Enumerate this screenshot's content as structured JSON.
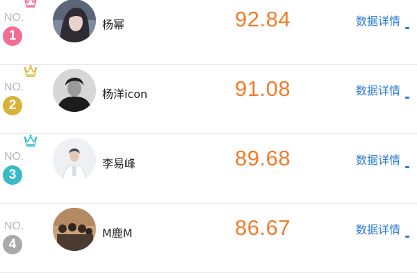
{
  "ranking": {
    "items": [
      {
        "no_label": "NO.",
        "rank": "1",
        "name": "杨幂",
        "score": "92.84",
        "detail_label": "数据详情",
        "badge_color": "#f26d8f",
        "crown_color": "#f06a95",
        "avatar_icon": "female-portrait"
      },
      {
        "no_label": "NO.",
        "rank": "2",
        "name": "杨洋icon",
        "score": "91.08",
        "detail_label": "数据详情",
        "badge_color": "#d8b33c",
        "crown_color": "#e0b73a",
        "avatar_icon": "male-portrait-dark"
      },
      {
        "no_label": "NO.",
        "rank": "3",
        "name": "李易峰",
        "score": "89.68",
        "detail_label": "数据详情",
        "badge_color": "#3ab9c9",
        "crown_color": "#38bfd0",
        "avatar_icon": "male-portrait-light"
      },
      {
        "no_label": "NO.",
        "rank": "4",
        "name": "M鹿M",
        "score": "86.67",
        "detail_label": "数据详情",
        "badge_color": "#a9a9a9",
        "crown_color": "",
        "avatar_icon": "group-photo"
      }
    ]
  },
  "colors": {
    "score": "#f47a2a",
    "link": "#2b7bd2",
    "divider": "#e3e3e3"
  }
}
